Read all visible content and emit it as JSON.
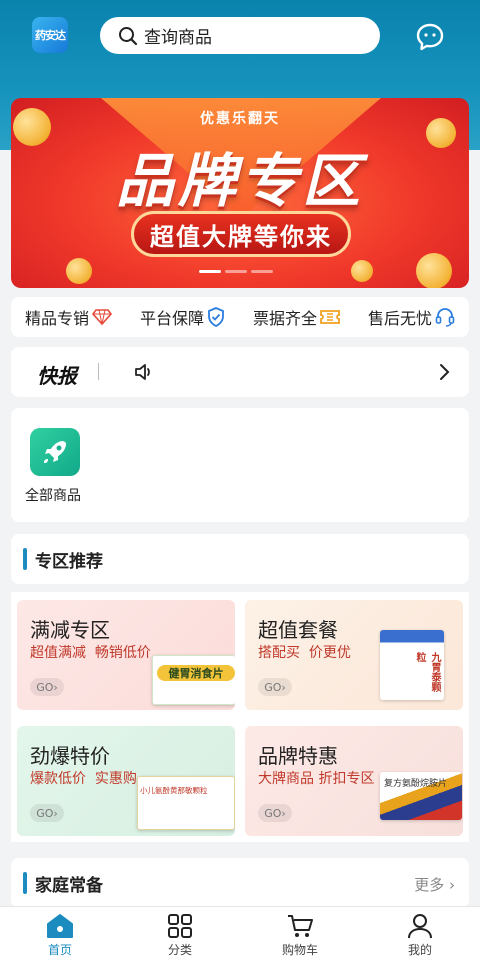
{
  "header": {
    "logo_text": "药安达",
    "search_placeholder": "查询商品",
    "message_icon": "chat-bubble-icon"
  },
  "banner": {
    "subtitle": "优惠乐翻天",
    "title": "品牌专区",
    "slogan": "超值大牌等你来"
  },
  "features": [
    {
      "label": "精品专销",
      "icon": "diamond-icon"
    },
    {
      "label": "平台保障",
      "icon": "shield-check-icon"
    },
    {
      "label": "票据齐全",
      "icon": "ticket-icon"
    },
    {
      "label": "售后无忧",
      "icon": "headset-icon"
    }
  ],
  "news": {
    "label": "快报"
  },
  "categories": [
    {
      "label": "全部商品",
      "icon": "rocket-icon"
    }
  ],
  "zone": {
    "title": "专区推荐",
    "cards": [
      {
        "title": "满减专区",
        "desc1": "超值满减",
        "desc2": "畅销低价",
        "go": "GO",
        "product": "健胃消食片",
        "bg": "#fbe3e3"
      },
      {
        "title": "超值套餐",
        "desc1": "搭配买",
        "desc2": "价更优",
        "go": "GO",
        "product": "九胃泰颗粒",
        "bg": "#fbeee3"
      },
      {
        "title": "劲爆特价",
        "desc1": "爆款低价",
        "desc2": "实惠购",
        "go": "GO",
        "product": "小儿氨酚黄那敏颗粒",
        "bg": "#e2f5ea"
      },
      {
        "title": "品牌特惠",
        "desc1": "大牌商品",
        "desc2": "折扣专区",
        "go": "GO",
        "product": "复方氨酚烷胺片",
        "bg": "#fbe6e3"
      }
    ]
  },
  "family": {
    "title": "家庭常备",
    "more": "更多"
  },
  "tabbar": [
    {
      "label": "首页",
      "icon": "home-icon",
      "active": true
    },
    {
      "label": "分类",
      "icon": "grid-icon",
      "active": false
    },
    {
      "label": "购物车",
      "icon": "cart-icon",
      "active": false
    },
    {
      "label": "我的",
      "icon": "user-icon",
      "active": false
    }
  ],
  "colors": {
    "primary": "#1b8bc0",
    "header": "#0a83ad",
    "banner_red": "#f0382a"
  }
}
